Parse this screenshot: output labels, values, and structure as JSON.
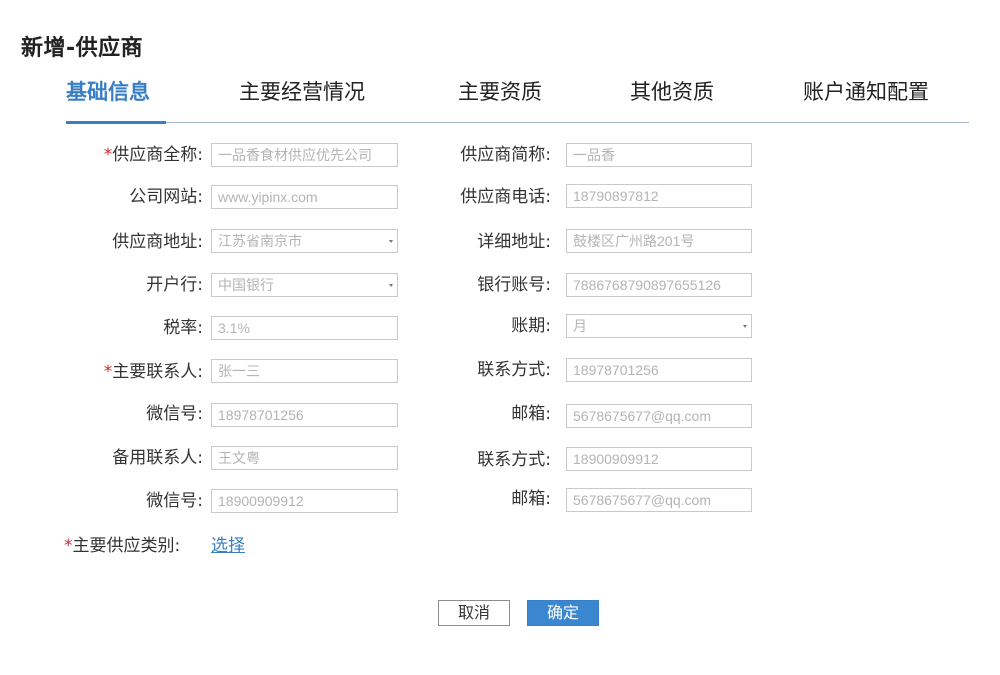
{
  "page": {
    "title": "新增-供应商"
  },
  "tabs": [
    {
      "label": "基础信息",
      "active": true
    },
    {
      "label": "主要经营情况"
    },
    {
      "label": "主要资质"
    },
    {
      "label": "其他资质"
    },
    {
      "label": "账户通知配置"
    }
  ],
  "form": {
    "left": [
      {
        "label": "供应商全称:",
        "required": true,
        "value": "一品香食材供应优先公司",
        "type": "text"
      },
      {
        "label": "公司网站:",
        "value": "www.yipinx.com",
        "type": "text"
      },
      {
        "label": "供应商地址:",
        "value": "江苏省南京市",
        "type": "select"
      },
      {
        "label": "开户行:",
        "value": "中国银行",
        "type": "select"
      },
      {
        "label": "税率:",
        "value": "3.1%",
        "type": "text"
      },
      {
        "label": "主要联系人:",
        "required": true,
        "value": "张一三",
        "type": "text"
      },
      {
        "label": "微信号:",
        "value": "18978701256",
        "type": "text"
      },
      {
        "label": "备用联系人:",
        "value": "王文粤",
        "type": "text"
      },
      {
        "label": "微信号:",
        "value": "18900909912",
        "type": "text"
      }
    ],
    "right": [
      {
        "label": "供应商简称:",
        "value": "一品香",
        "type": "text"
      },
      {
        "label": "供应商电话:",
        "value": "18790897812",
        "type": "text"
      },
      {
        "label": "详细地址:",
        "value": "鼓楼区广州路201号",
        "type": "text"
      },
      {
        "label": "银行账号:",
        "value": "7886768790897655126",
        "type": "text"
      },
      {
        "label": "账期:",
        "value": "月",
        "type": "select"
      },
      {
        "label": "联系方式:",
        "value": "18978701256",
        "type": "text"
      },
      {
        "label": "邮箱:",
        "value": "5678675677@qq.com",
        "type": "text"
      },
      {
        "label": "联系方式:",
        "value": "18900909912",
        "type": "text"
      },
      {
        "label": "邮箱:",
        "value": "5678675677@qq.com",
        "type": "text"
      }
    ],
    "category": {
      "required_mark": "*",
      "label": "主要供应类别:",
      "link_label": "选择"
    },
    "required_mark": "*"
  },
  "buttons": {
    "cancel_label": "取消",
    "ok_label": "确定"
  },
  "colors": {
    "accent": "#3a7fc4",
    "required": "#d0282e",
    "border": "#c9c9c9"
  }
}
